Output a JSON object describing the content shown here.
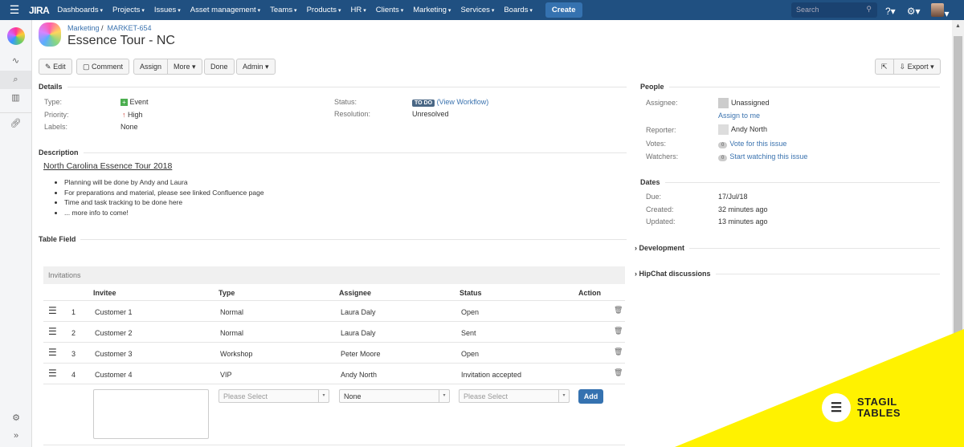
{
  "nav": {
    "logo": "JIRA",
    "menus": [
      "Dashboards",
      "Projects",
      "Issues",
      "Asset management",
      "Teams",
      "Products",
      "HR",
      "Clients",
      "Marketing",
      "Services",
      "Boards"
    ],
    "create": "Create",
    "search_placeholder": "Search"
  },
  "issue": {
    "project": "Marketing",
    "key": "MARKET-654",
    "title": "Essence Tour - NC"
  },
  "toolbar": {
    "edit": "Edit",
    "comment": "Comment",
    "assign": "Assign",
    "more": "More",
    "done": "Done",
    "admin": "Admin",
    "export": "Export"
  },
  "details": {
    "heading": "Details",
    "type_label": "Type:",
    "type": "Event",
    "priority_label": "Priority:",
    "priority": "High",
    "labels_label": "Labels:",
    "labels": "None",
    "status_label": "Status:",
    "status": "TO DO",
    "workflow": "(View Workflow)",
    "resolution_label": "Resolution:",
    "resolution": "Unresolved"
  },
  "description": {
    "heading": "Description",
    "title": "North Carolina Essence Tour 2018",
    "bullets": [
      "Planning will be done by Andy and Laura",
      "For preparations and material, please see linked Confluence page",
      "Time and task tracking to be done here",
      "... more info to come!"
    ]
  },
  "table_field": {
    "heading": "Table Field",
    "caption": "Invitations",
    "columns": [
      "Invitee",
      "Type",
      "Assignee",
      "Status",
      "Action"
    ],
    "rows": [
      {
        "n": "1",
        "invitee": "Customer 1",
        "type": "Normal",
        "assignee": "Laura Daly",
        "status": "Open"
      },
      {
        "n": "2",
        "invitee": "Customer 2",
        "type": "Normal",
        "assignee": "Laura Daly",
        "status": "Sent"
      },
      {
        "n": "3",
        "invitee": "Customer 3",
        "type": "Workshop",
        "assignee": "Peter Moore",
        "status": "Open"
      },
      {
        "n": "4",
        "invitee": "Customer 4",
        "type": "VIP",
        "assignee": "Andy North",
        "status": "Invitation accepted"
      }
    ],
    "form": {
      "type": "Please Select",
      "assignee": "None",
      "status": "Please Select",
      "add": "Add"
    }
  },
  "people": {
    "heading": "People",
    "assignee_label": "Assignee:",
    "assignee": "Unassigned",
    "assign_me": "Assign to me",
    "reporter_label": "Reporter:",
    "reporter": "Andy North",
    "votes_label": "Votes:",
    "votes": "0",
    "vote_link": "Vote for this issue",
    "watchers_label": "Watchers:",
    "watchers": "0",
    "watch_link": "Start watching this issue"
  },
  "dates": {
    "heading": "Dates",
    "due_label": "Due:",
    "due": "17/Jul/18",
    "created_label": "Created:",
    "created": "32 minutes ago",
    "updated_label": "Updated:",
    "updated": "13 minutes ago"
  },
  "development": "Development",
  "hipchat": "HipChat discussions",
  "brand": {
    "line1": "STAGIL",
    "line2": "TABLES",
    "color": "#fff200"
  }
}
